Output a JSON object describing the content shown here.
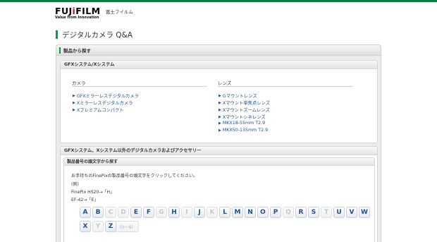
{
  "header": {
    "logo_main": "FUJ",
    "logo_accent": "i",
    "logo_rest": "FILM",
    "logo_tagline": "Value from Innovation",
    "company_name": "富士フイルム"
  },
  "page_title": "デジタルカメラ Q&A",
  "panel": {
    "heading": "製品から探す",
    "gfx_section": {
      "heading": "GFXシステム/Xシステム",
      "camera_column": {
        "heading": "カメラ",
        "links": [
          "GFXミラーレスデジタルカメラ",
          "Xミラーレスデジタルカメラ",
          "Xプレミアムコンパクト"
        ]
      },
      "lens_column": {
        "heading": "レンズ",
        "links": [
          "Gマウントレンズ",
          "Xマウント単焦点レンズ",
          "Xマウントズームレンズ",
          "Xマウントシネレンズ",
          "MKX18-55mm T2.9",
          "MKX50-135mm T2.9"
        ]
      }
    },
    "other_section": {
      "heading": "GFXシステム、Xシステム以外のデジタルカメラおよびアクセサリー",
      "search_box": {
        "heading": "製品番号の頭文字から探す",
        "help_lines": [
          "お手持ちのFinePixの製品番号の頭文字をクリックしてください。",
          "(例)",
          "FinePix HS20→「H」",
          "EF-42→「E」"
        ],
        "letters_row1": [
          {
            "label": "A",
            "enabled": true
          },
          {
            "label": "B",
            "enabled": true
          },
          {
            "label": "C",
            "enabled": false
          },
          {
            "label": "D",
            "enabled": false
          },
          {
            "label": "E",
            "enabled": true
          },
          {
            "label": "F",
            "enabled": true
          },
          {
            "label": "G",
            "enabled": false
          },
          {
            "label": "H",
            "enabled": true
          },
          {
            "label": "I",
            "enabled": false
          },
          {
            "label": "J",
            "enabled": true
          },
          {
            "label": "K",
            "enabled": false
          },
          {
            "label": "L",
            "enabled": true
          },
          {
            "label": "M",
            "enabled": true
          },
          {
            "label": "N",
            "enabled": true
          },
          {
            "label": "O",
            "enabled": true
          },
          {
            "label": "P",
            "enabled": true
          },
          {
            "label": "Q",
            "enabled": false
          },
          {
            "label": "R",
            "enabled": true
          },
          {
            "label": "S",
            "enabled": true
          },
          {
            "label": "T",
            "enabled": false
          },
          {
            "label": "U",
            "enabled": true
          },
          {
            "label": "V",
            "enabled": true
          },
          {
            "label": "W",
            "enabled": true
          }
        ],
        "letters_row2": [
          {
            "label": "X",
            "enabled": true
          },
          {
            "label": "Y",
            "enabled": false
          },
          {
            "label": "Z",
            "enabled": true
          }
        ],
        "digit_button": "数字（0〜9）"
      }
    }
  },
  "colors": {
    "brand_green": "#00a040",
    "link_blue": "#1a4f9c",
    "logo_red": "#e60012"
  }
}
